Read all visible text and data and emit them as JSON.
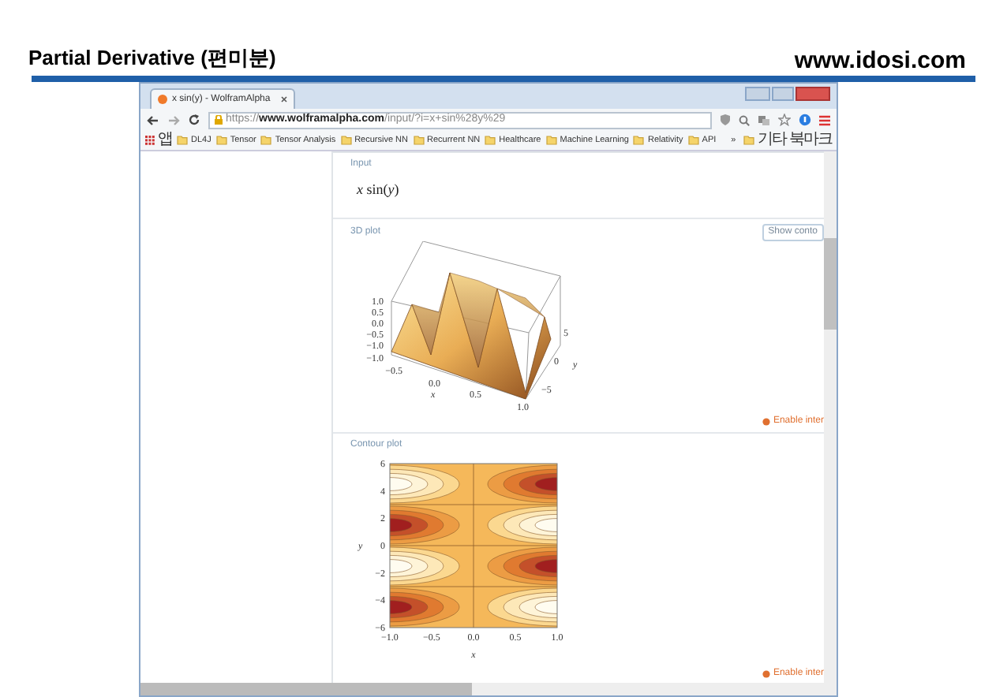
{
  "slide": {
    "title": "Partial Derivative (편미분)",
    "site": "www.idosi.com"
  },
  "browser": {
    "tab_title": "x sin(y) - WolframAlpha",
    "url": "https://**www.wolframalpha.com**/input/?i=x+sin%28y%29",
    "bookmarks": [
      {
        "label": "앱",
        "kind": "apps"
      },
      {
        "label": "DL4J",
        "kind": "folder"
      },
      {
        "label": "Tensor",
        "kind": "folder"
      },
      {
        "label": "Tensor Analysis",
        "kind": "folder"
      },
      {
        "label": "Recursive NN",
        "kind": "folder"
      },
      {
        "label": "Recurrent NN",
        "kind": "folder"
      },
      {
        "label": "Healthcare",
        "kind": "folder"
      },
      {
        "label": "Machine Learning",
        "kind": "folder"
      },
      {
        "label": "Relativity",
        "kind": "folder"
      },
      {
        "label": "API",
        "kind": "folder"
      },
      {
        "label": "»",
        "kind": "more"
      },
      {
        "label": "기타 북마크",
        "kind": "folder"
      }
    ]
  },
  "pods": [
    {
      "kind": "input",
      "title": "Input",
      "formula": "*x* sin(*y*)"
    },
    {
      "kind": "plot3d",
      "title": "3D plot",
      "button": "Show conto",
      "link": "Enable inter",
      "z_ticks": [
        "1.0",
        "0.5",
        "0.0",
        "−0.5",
        "−1.0"
      ],
      "x_ticks": [
        "−1.0",
        "−0.5",
        "0.0",
        "0.5",
        "1.0"
      ],
      "y_ticks": [
        "5",
        "0",
        "−5"
      ],
      "x_label": "x",
      "y_label": "y"
    },
    {
      "kind": "contour",
      "title": "Contour plot",
      "link": "Enable inter",
      "y_ticks": [
        "6",
        "4",
        "2",
        "0",
        "−2",
        "−4",
        "−6"
      ],
      "x_ticks": [
        "−1.0",
        "−0.5",
        "0.0",
        "0.5",
        "1.0"
      ],
      "x_label": "x",
      "y_label": "y"
    }
  ]
}
